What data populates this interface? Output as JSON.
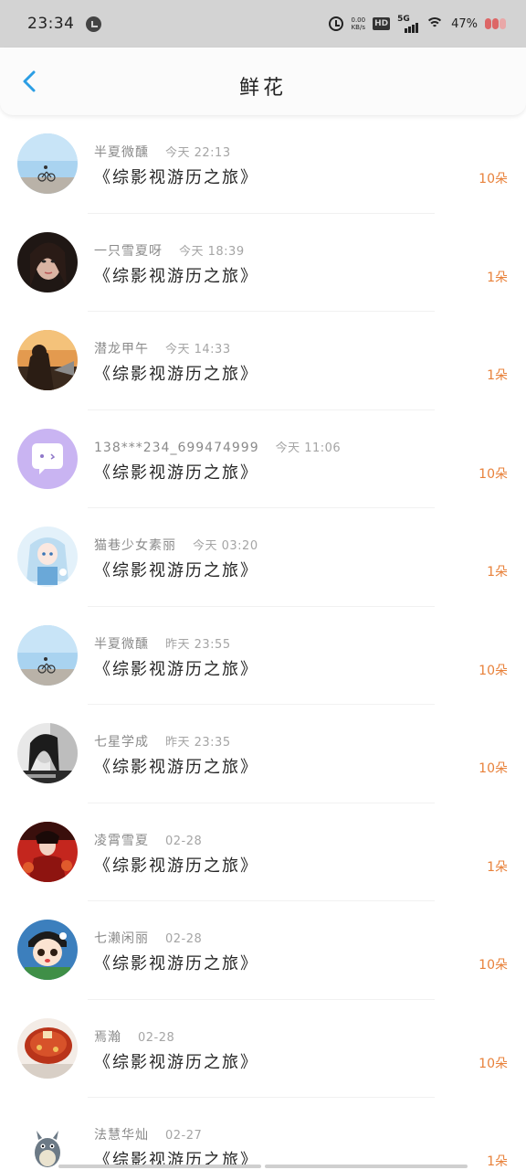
{
  "status_bar": {
    "time": "23:34",
    "net_speed_value": "0.00",
    "net_speed_unit": "KB/s",
    "hd_label": "HD",
    "network_label": "5G",
    "battery_text": "47%"
  },
  "header": {
    "title": "鲜花",
    "back_icon": "chevron-left-icon"
  },
  "colors": {
    "accent_blue": "#2b9ee4",
    "count_orange": "#e8813a"
  },
  "items": [
    {
      "name": "半夏微醺",
      "time": "今天 22:13",
      "title": "《综影视游历之旅》",
      "count": "10朵",
      "avatar": "sky-bicycle"
    },
    {
      "name": "一只雪夏呀",
      "time": "今天 18:39",
      "title": "《综影视游历之旅》",
      "count": "1朵",
      "avatar": "girl-portrait"
    },
    {
      "name": "潜龙甲午",
      "time": "今天 14:33",
      "title": "《综影视游历之旅》",
      "count": "1朵",
      "avatar": "sunset-person"
    },
    {
      "name": "138***234_699474999",
      "time": "今天 11:06",
      "title": "《综影视游历之旅》",
      "count": "10朵",
      "avatar": "chat-bubble-default"
    },
    {
      "name": "猫巷少女素丽",
      "time": "今天 03:20",
      "title": "《综影视游历之旅》",
      "count": "1朵",
      "avatar": "anime-girl"
    },
    {
      "name": "半夏微醺",
      "time": "昨天 23:55",
      "title": "《综影视游历之旅》",
      "count": "10朵",
      "avatar": "sky-bicycle"
    },
    {
      "name": "七星学成",
      "time": "昨天 23:35",
      "title": "《综影视游历之旅》",
      "count": "10朵",
      "avatar": "bw-portrait"
    },
    {
      "name": "凌霄雪夏",
      "time": "02-28",
      "title": "《综影视游历之旅》",
      "count": "1朵",
      "avatar": "red-costume"
    },
    {
      "name": "七濑闲丽",
      "time": "02-28",
      "title": "《综影视游历之旅》",
      "count": "10朵",
      "avatar": "cartoon-boy"
    },
    {
      "name": "焉瀚",
      "time": "02-28",
      "title": "《综影视游历之旅》",
      "count": "10朵",
      "avatar": "food-bowl"
    },
    {
      "name": "法慧华灿",
      "time": "02-27",
      "title": "《综影视游历之旅》",
      "count": "1朵",
      "avatar": "totoro"
    }
  ]
}
